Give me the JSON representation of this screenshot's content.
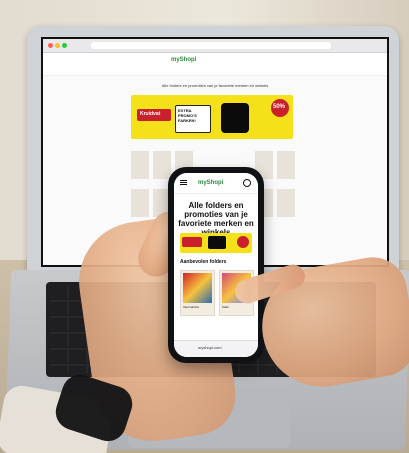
{
  "laptop_screen": {
    "logo": "myShopi",
    "heading": "Alle folders en promoties van je favoriete merken en winkels",
    "banner": {
      "brand": "Kruidvat",
      "headline": "EXTRA PROMO'S FARKEN!",
      "badge": "50%"
    }
  },
  "phone_screen": {
    "logo": "myShopi",
    "heading": "Alle folders en promoties van je favoriete merken en winkels",
    "section_title": "Aanbevolen folders",
    "folders": [
      {
        "name": "Intermarché"
      },
      {
        "name": "Kiabi"
      }
    ],
    "url": "myshopi.com"
  },
  "colors": {
    "accent_green": "#2d8a3e",
    "banner_yellow": "#f4e11a",
    "banner_red": "#c9202c"
  }
}
